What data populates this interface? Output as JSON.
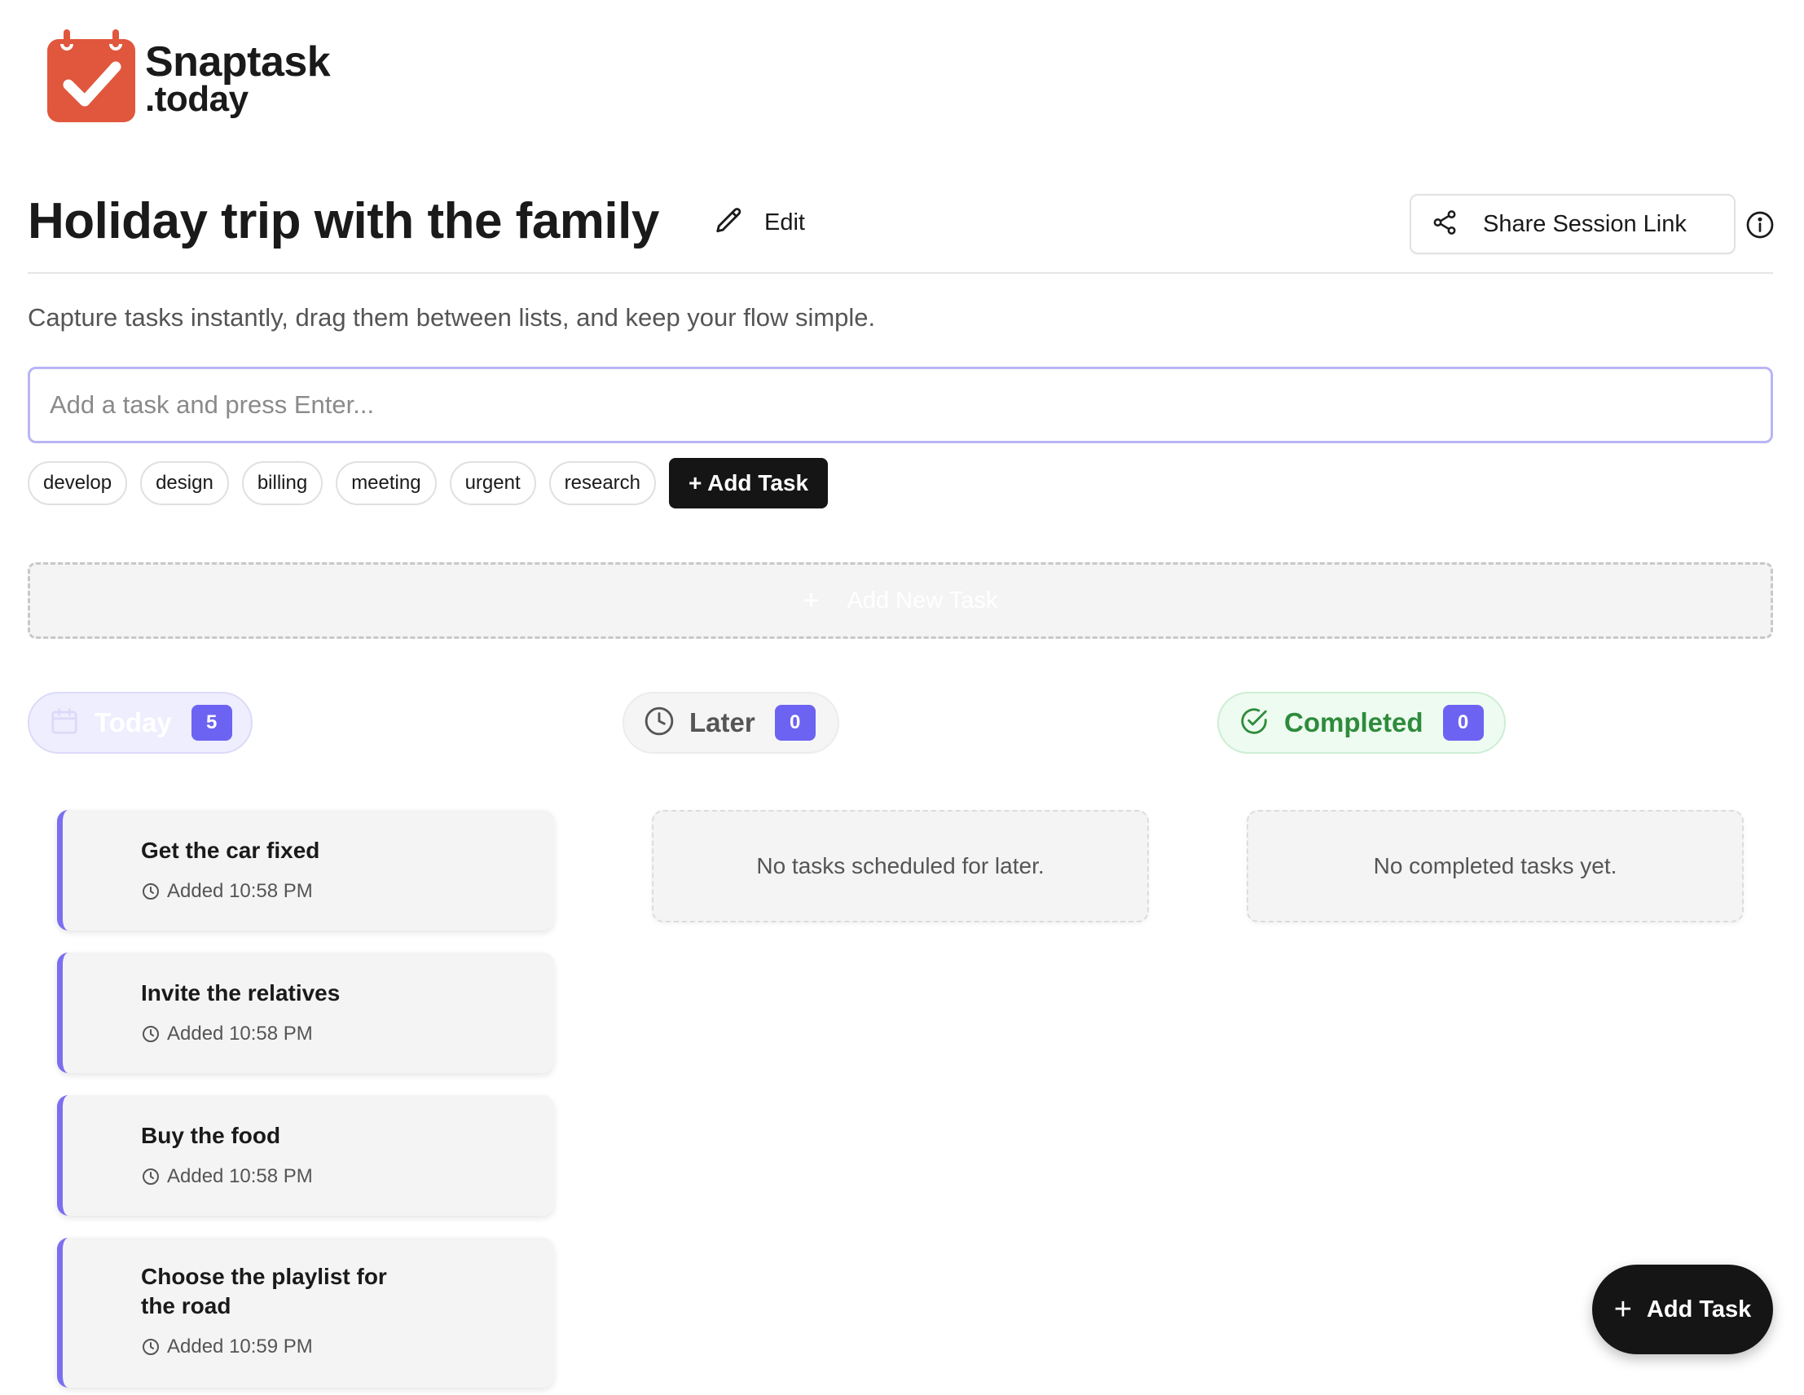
{
  "brand": {
    "name": "Snaptask",
    "domain": ".today",
    "accent": "#e0573d"
  },
  "header": {
    "title": "Holiday trip with the family",
    "edit_label": "Edit",
    "share_label": "Share Session Link"
  },
  "subtitle": "Capture tasks instantly, drag them between lists, and keep your flow simple.",
  "task_input": {
    "placeholder": "Add a task and press Enter..."
  },
  "tags": [
    "develop",
    "design",
    "billing",
    "meeting",
    "urgent",
    "research"
  ],
  "add_task_button": "+ Add Task",
  "add_new_task": {
    "icon": "plus-icon",
    "label": "Add New Task"
  },
  "columns": {
    "today": {
      "label": "Today",
      "count": "5",
      "icon": "calendar-icon",
      "color": "#6d63f2"
    },
    "later": {
      "label": "Later",
      "count": "0",
      "icon": "clock-icon",
      "empty_text": "No tasks scheduled for later."
    },
    "completed": {
      "label": "Completed",
      "count": "0",
      "icon": "check-circle-icon",
      "color": "#2e8b3c",
      "empty_text": "No completed tasks yet."
    }
  },
  "tasks": [
    {
      "title": "Get the car fixed",
      "added": "Added 10:58 PM"
    },
    {
      "title": "Invite the relatives",
      "added": "Added 10:58 PM"
    },
    {
      "title": "Buy the food",
      "added": "Added 10:58 PM"
    },
    {
      "title_line1": "Choose the playlist for",
      "title_line2": "the road",
      "added": "Added 10:59 PM"
    }
  ],
  "fab": {
    "icon": "plus-icon",
    "label": "Add Task"
  }
}
